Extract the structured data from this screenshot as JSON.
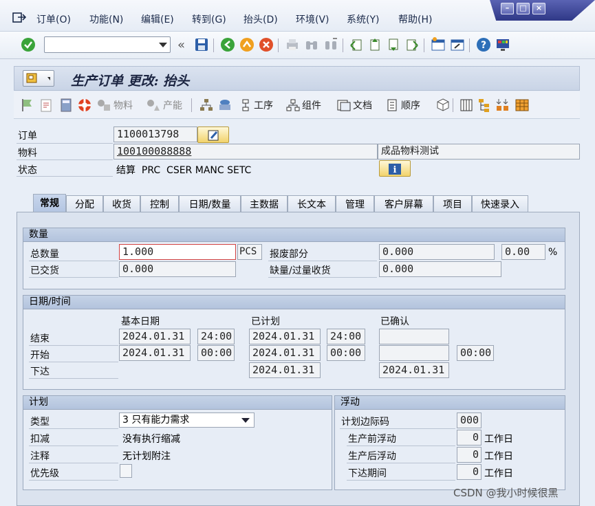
{
  "menu": {
    "items": [
      "订单(O)",
      "功能(N)",
      "编辑(E)",
      "转到(G)",
      "抬头(D)",
      "环境(V)",
      "系统(Y)",
      "帮助(H)"
    ]
  },
  "title": "生产订单 更改: 抬头",
  "app_toolbar": {
    "material": "物料",
    "capacity": "产能",
    "operations": "工序",
    "components": "组件",
    "documents": "文档",
    "sequences": "顺序"
  },
  "header": {
    "order_label": "订单",
    "order_value": "1100013798",
    "material_label": "物料",
    "material_value": "100100088888",
    "material_desc": "成品物料测试",
    "status_label": "状态",
    "status_value": "结算  PRC  CSER MANC SETC"
  },
  "tabs": [
    "常规",
    "分配",
    "收货",
    "控制",
    "日期/数量",
    "主数据",
    "长文本",
    "管理",
    "客户屏幕",
    "项目",
    "快速录入"
  ],
  "quantity": {
    "title": "数量",
    "total_label": "总数量",
    "total_value": "1.000",
    "unit": "PCS",
    "scrap_label": "报废部分",
    "scrap_value": "0.000",
    "scrap_pct": "0.00",
    "pct_sign": "%",
    "delivered_label": "已交货",
    "delivered_value": "0.000",
    "short_over_label": "缺量/过量收货",
    "short_over_value": "0.000"
  },
  "dates": {
    "title": "日期/时间",
    "col_basic": "基本日期",
    "col_scheduled": "已计划",
    "col_confirmed": "已确认",
    "end_label": "结束",
    "end_basic_date": "2024.01.31",
    "end_basic_time": "24:00",
    "end_sched_date": "2024.01.31",
    "end_sched_time": "24:00",
    "end_conf_date": "",
    "start_label": "开始",
    "start_basic_date": "2024.01.31",
    "start_basic_time": "00:00",
    "start_sched_date": "2024.01.31",
    "start_sched_time": "00:00",
    "start_conf_date": "",
    "start_conf_time": "00:00",
    "release_label": "下达",
    "release_sched_date": "2024.01.31",
    "release_conf_date": "2024.01.31"
  },
  "planning": {
    "title": "计划",
    "type_label": "类型",
    "type_value": "3 只有能力需求",
    "reduction_label": "扣减",
    "reduction_value": "没有执行缩减",
    "note_label": "注释",
    "note_value": "无计划附注",
    "priority_label": "优先级"
  },
  "float": {
    "title": "浮动",
    "margin_key_label": "计划边际码",
    "margin_key_value": "000",
    "pre_label": "生产前浮动",
    "pre_value": "0",
    "post_label": "生产后浮动",
    "post_value": "0",
    "release_label": "下达期间",
    "release_value": "0",
    "workday": "工作日"
  },
  "watermark": "CSDN @我小时候很黑",
  "colors": {
    "accent": "#2f3887",
    "ok_green": "#3aa33a"
  }
}
